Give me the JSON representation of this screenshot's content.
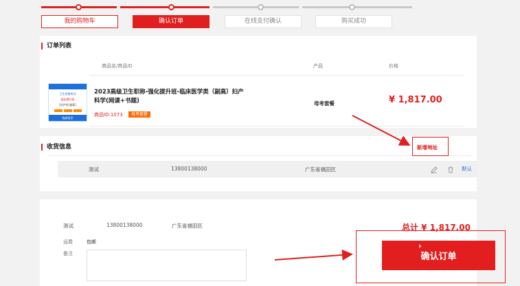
{
  "colors": {
    "accent": "#e01f1f",
    "inactive": "#bbbbbb",
    "badge": "#ff6a00"
  },
  "steps": [
    {
      "label": "我的购物车"
    },
    {
      "label": "确认订单"
    },
    {
      "label": "在线支付确认"
    },
    {
      "label": "购买成功"
    }
  ],
  "order_list": {
    "title": "订单列表",
    "headers": {
      "name": "商品名/商品ID",
      "product": "产品",
      "price": "价格"
    },
    "item": {
      "title": "2023高级卫生职称-强化提升班-临床医学类（副高）妇产科学(网课+书题)",
      "id_label": "商品ID:",
      "id": "1073",
      "badge": "母考套餐",
      "product": "母考套餐",
      "price": "¥ 1,817.00",
      "thumb_texts": [
        "卫生资格考试",
        "强化提升班",
        "[妇产科·副高]",
        "临床医学"
      ]
    }
  },
  "shipping": {
    "title": "收货信息",
    "new_address": "新增地址",
    "address": {
      "name": "测试",
      "phone": "13800138000",
      "region": "广东省福田区",
      "default": "默认"
    }
  },
  "summary": {
    "name": "测试",
    "phone": "13800138000",
    "region": "广东省福田区",
    "shipping_label": "运费",
    "shipping_value": "包邮",
    "remark_label": "备注",
    "total": "总计 ¥ 1,817.00",
    "confirm": "确认订单"
  }
}
